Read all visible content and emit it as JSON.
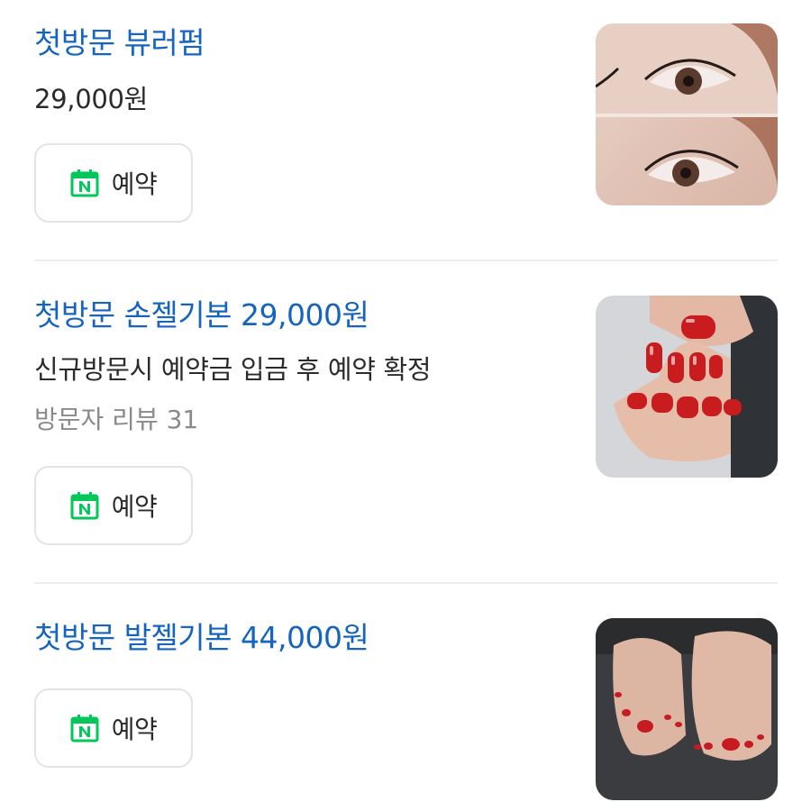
{
  "items": [
    {
      "title": "첫방문 뷰러펌",
      "price": "29,000원",
      "button_label": "예약",
      "image_icon": "eyelash-perm-photo"
    },
    {
      "title": "첫방문 손젤기본 29,000원",
      "description": "신규방문시 예약금 입금 후 예약 확정",
      "reviews": "방문자 리뷰 31",
      "button_label": "예약",
      "image_icon": "red-gel-manicure-photo"
    },
    {
      "title": "첫방문 발젤기본 44,000원",
      "button_label": "예약",
      "image_icon": "red-gel-pedicure-photo"
    }
  ],
  "colors": {
    "title": "#1565c0",
    "text": "#2b2b2b",
    "muted": "#8a8a8a",
    "naver_green": "#03c75a",
    "border": "#e4e4e4"
  }
}
